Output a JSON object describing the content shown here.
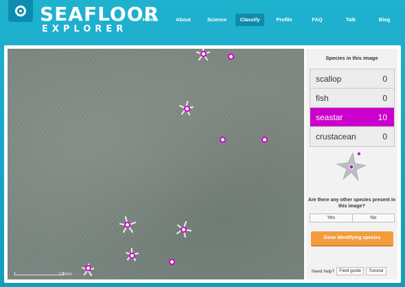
{
  "brand": {
    "line1": "SEAFLOOR",
    "line2": "EXPLORER",
    "logo_icon": "eye-ring-icon"
  },
  "nav": {
    "items": [
      {
        "label": "Home",
        "active": false
      },
      {
        "label": "About",
        "active": false
      },
      {
        "label": "Science",
        "active": false
      },
      {
        "label": "Classify",
        "active": true
      },
      {
        "label": "Profile",
        "active": false
      },
      {
        "label": "FAQ",
        "active": false
      },
      {
        "label": "Talk",
        "active": false
      },
      {
        "label": "Blog",
        "active": false
      }
    ]
  },
  "image": {
    "scale_label": "100mm",
    "marker_color": "#d000c8"
  },
  "side": {
    "title": "Species in this image",
    "species": [
      {
        "name": "scallop",
        "count": "0",
        "selected": false
      },
      {
        "name": "fish",
        "count": "0",
        "selected": false
      },
      {
        "name": "seastar",
        "count": "10",
        "selected": true
      },
      {
        "name": "crustacean",
        "count": "0",
        "selected": false
      }
    ],
    "selected_color": "#cc00cc",
    "selected_icon": "seastar-icon",
    "question": "Are there any other species present in this image?",
    "yes_label": "Yes",
    "no_label": "No",
    "done_label": "Done identifying species",
    "done_color": "#f39c3e",
    "help_label": "Need help?",
    "field_guide_label": "Field guide",
    "tutorial_label": "Tutorial"
  }
}
